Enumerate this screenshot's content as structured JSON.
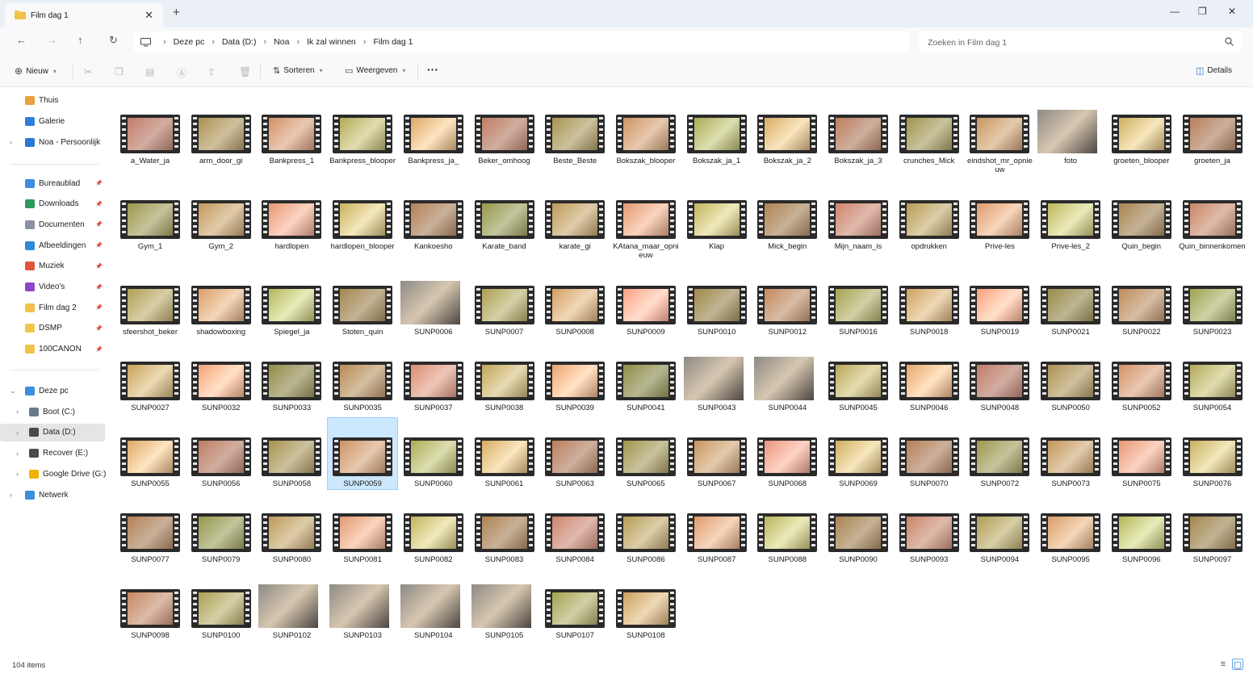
{
  "tab": {
    "title": "Film dag 1",
    "close": "✕",
    "new": "+"
  },
  "window_controls": {
    "minimize": "—",
    "restore": "❐",
    "close": "✕"
  },
  "address": {
    "crumbs": [
      "Deze pc",
      "Data (D:)",
      "Noa",
      "Ik zal winnen",
      "Film dag 1"
    ],
    "search_placeholder": "Zoeken in Film dag 1"
  },
  "toolbar": {
    "new": "Nieuw",
    "sort": "Sorteren",
    "view": "Weergeven",
    "more": "···",
    "details": "Details"
  },
  "sidebar": {
    "top": [
      {
        "label": "Thuis",
        "icon": "home-icon",
        "color": "#e8a13c"
      },
      {
        "label": "Galerie",
        "icon": "gallery-icon",
        "color": "#2f7fd8"
      },
      {
        "label": "Noa - Persoonlijk",
        "icon": "cloud-icon",
        "color": "#2a7ad6"
      }
    ],
    "pinned": [
      {
        "label": "Bureaublad",
        "icon": "desktop-icon",
        "color": "#3b8ee0"
      },
      {
        "label": "Downloads",
        "icon": "download-icon",
        "color": "#2c9a5a"
      },
      {
        "label": "Documenten",
        "icon": "documents-icon",
        "color": "#8a93a3"
      },
      {
        "label": "Afbeeldingen",
        "icon": "pictures-icon",
        "color": "#2d8ad6"
      },
      {
        "label": "Muziek",
        "icon": "music-icon",
        "color": "#e0563c"
      },
      {
        "label": "Video's",
        "icon": "videos-icon",
        "color": "#8c47c9"
      },
      {
        "label": "Film dag 2",
        "icon": "folder-icon",
        "color": "#f1c34a"
      },
      {
        "label": "DSMP",
        "icon": "folder-icon",
        "color": "#f1c34a"
      },
      {
        "label": "100CANON",
        "icon": "folder-icon",
        "color": "#f1c34a"
      }
    ],
    "pc": {
      "label": "Deze pc",
      "icon": "pc-icon",
      "color": "#3b8ee0"
    },
    "drives": [
      {
        "label": "Boot (C:)",
        "icon": "drive-icon",
        "color": "#6b7a8a"
      },
      {
        "label": "Data (D:)",
        "icon": "drive-icon",
        "color": "#4a4a4a"
      },
      {
        "label": "Recover (E:)",
        "icon": "drive-icon",
        "color": "#4a4a4a"
      },
      {
        "label": "Google Drive (G:)",
        "icon": "google-drive-icon",
        "color": "#f0b400"
      }
    ],
    "network": {
      "label": "Netwerk",
      "icon": "network-icon",
      "color": "#3b8ee0"
    }
  },
  "files": [
    "a_Water_ja",
    "arm_door_gi",
    "Bankpress_1",
    "Bankpress_blooper",
    "Bankpress_ja_",
    "Beker_omhoog",
    "Beste_Beste",
    "Bokszak_blooper",
    "Bokszak_ja_1",
    "Bokszak_ja_2",
    "Bokszak_ja_3",
    "crunches_Mick",
    "eindshot_mr_opnieuw",
    "foto",
    "groeten_blooper",
    "groeten_ja",
    "Gym_1",
    "Gym_2",
    "hardlopen",
    "hardlopen_blooper",
    "Kankoesho",
    "Karate_band",
    "karate_gi",
    "KAtana_maar_opnieuw",
    "Klap",
    "Mick_begin",
    "Mijn_naam_is",
    "opdrukken",
    "Prive-les",
    "Prive-les_2",
    "Quin_begin",
    "Quin_binnenkomen",
    "sfeershot_beker",
    "shadowboxing",
    "Spiegel_ja",
    "Stoten_quin",
    "SUNP0006",
    "SUNP0007",
    "SUNP0008",
    "SUNP0009",
    "SUNP0010",
    "SUNP0012",
    "SUNP0016",
    "SUNP0018",
    "SUNP0019",
    "SUNP0021",
    "SUNP0022",
    "SUNP0023",
    "SUNP0027",
    "SUNP0032",
    "SUNP0033",
    "SUNP0035",
    "SUNP0037",
    "SUNP0038",
    "SUNP0039",
    "SUNP0041",
    "SUNP0043",
    "SUNP0044",
    "SUNP0045",
    "SUNP0046",
    "SUNP0048",
    "SUNP0050",
    "SUNP0052",
    "SUNP0054",
    "SUNP0055",
    "SUNP0056",
    "SUNP0058",
    "SUNP0059",
    "SUNP0060",
    "SUNP0061",
    "SUNP0063",
    "SUNP0065",
    "SUNP0067",
    "SUNP0068",
    "SUNP0069",
    "SUNP0070",
    "SUNP0072",
    "SUNP0073",
    "SUNP0075",
    "SUNP0076",
    "SUNP0077",
    "SUNP0079",
    "SUNP0080",
    "SUNP0081",
    "SUNP0082",
    "SUNP0083",
    "SUNP0084",
    "SUNP0086",
    "SUNP0087",
    "SUNP0088",
    "SUNP0090",
    "SUNP0093",
    "SUNP0094",
    "SUNP0095",
    "SUNP0096",
    "SUNP0097",
    "SUNP0098",
    "SUNP0100",
    "SUNP0102",
    "SUNP0103",
    "SUNP0104",
    "SUNP0105",
    "SUNP0107",
    "SUNP0108"
  ],
  "photo_files": [
    "foto",
    "SUNP0006",
    "SUNP0043",
    "SUNP0044",
    "SUNP0102",
    "SUNP0103",
    "SUNP0104",
    "SUNP0105"
  ],
  "selected_file": "SUNP0059",
  "status": {
    "count": "104 items"
  }
}
